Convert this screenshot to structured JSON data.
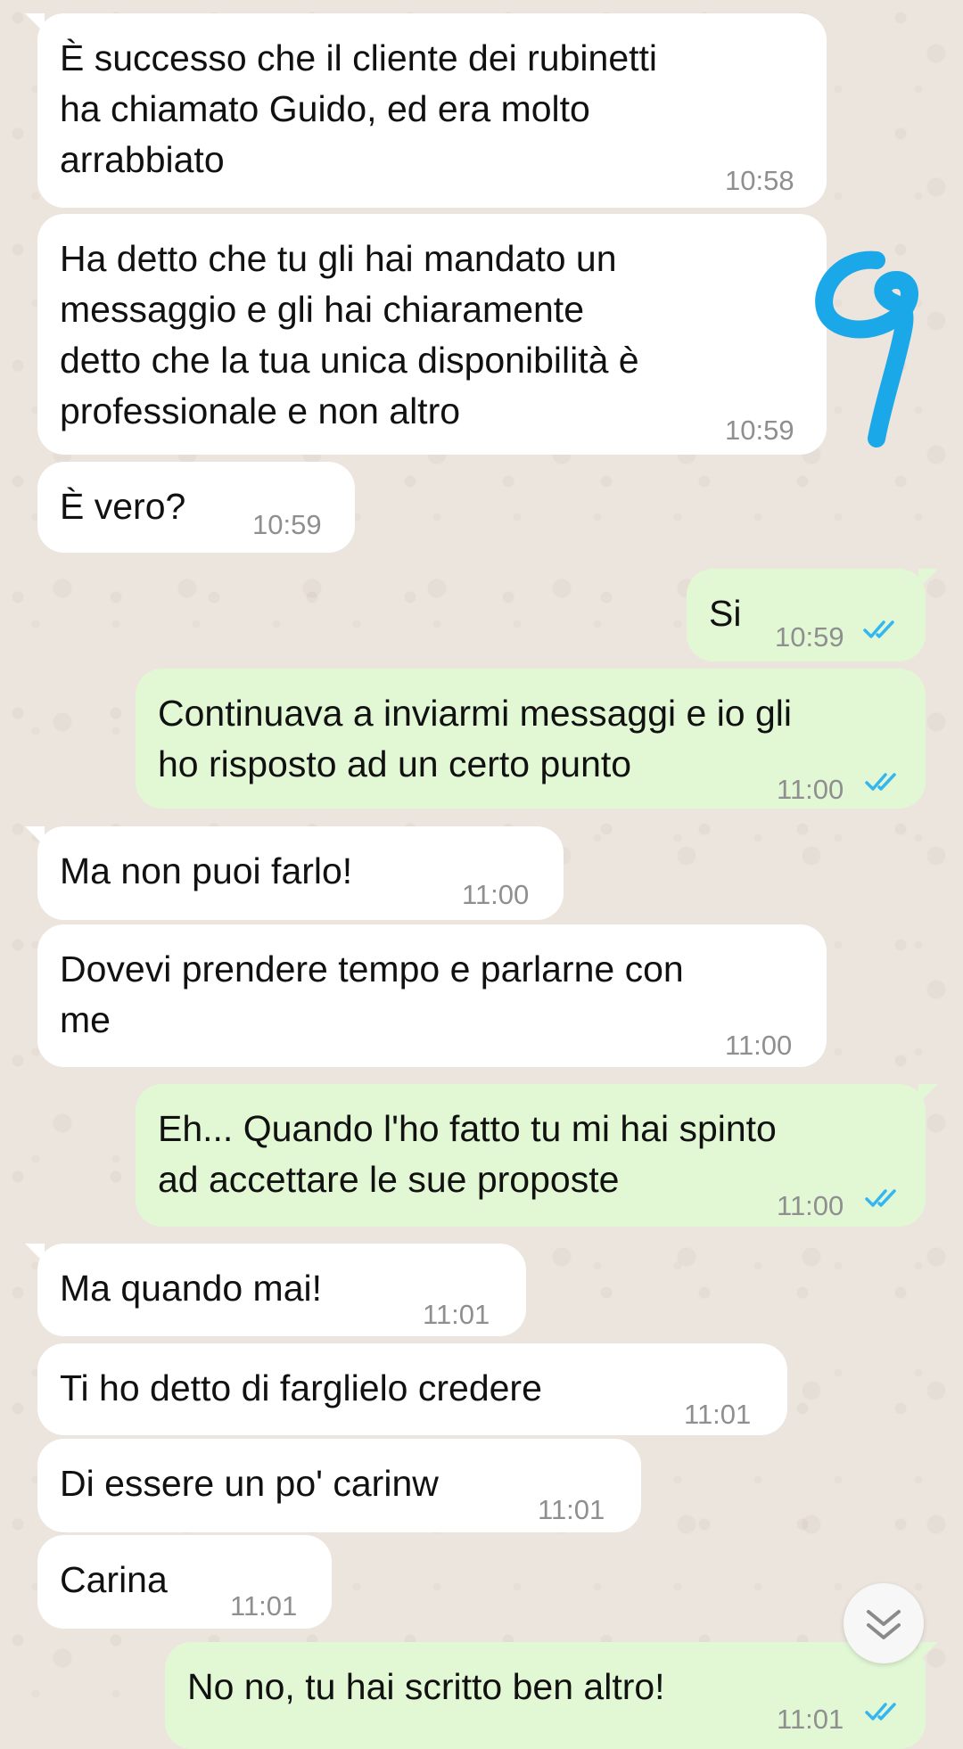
{
  "messages": [
    {
      "dir": "in",
      "lines": [
        "È successo che il cliente dei rubinetti",
        "ha chiamato Guido, ed era molto",
        "arrabbiato"
      ],
      "time": "10:58"
    },
    {
      "dir": "in",
      "lines": [
        "Ha detto che tu gli hai mandato un",
        "messaggio e gli hai chiaramente",
        "detto che la tua unica disponibilità è",
        "professionale e non altro"
      ],
      "time": "10:59"
    },
    {
      "dir": "in",
      "lines": [
        "È vero?"
      ],
      "time": "10:59"
    },
    {
      "dir": "out",
      "lines": [
        "Si"
      ],
      "time": "10:59",
      "status": "read"
    },
    {
      "dir": "out",
      "lines": [
        "Continuava a inviarmi messaggi e io gli",
        "ho risposto ad un certo punto"
      ],
      "time": "11:00",
      "status": "read"
    },
    {
      "dir": "in",
      "lines": [
        "Ma non puoi farlo!"
      ],
      "time": "11:00"
    },
    {
      "dir": "in",
      "lines": [
        "Dovevi prendere tempo e parlarne con",
        "me"
      ],
      "time": "11:00"
    },
    {
      "dir": "out",
      "lines": [
        "Eh... Quando l'ho fatto tu mi hai spinto",
        "ad accettare le sue proposte"
      ],
      "time": "11:00",
      "status": "read"
    },
    {
      "dir": "in",
      "lines": [
        "Ma quando mai!"
      ],
      "time": "11:01"
    },
    {
      "dir": "in",
      "lines": [
        "Ti ho detto di farglielo credere"
      ],
      "time": "11:01"
    },
    {
      "dir": "in",
      "lines": [
        "Di essere un po' carinw"
      ],
      "time": "11:01"
    },
    {
      "dir": "in",
      "lines": [
        "Carina"
      ],
      "time": "11:01"
    },
    {
      "dir": "out",
      "lines": [
        "No no, tu hai scritto ben altro!"
      ],
      "time": "11:01",
      "status": "read"
    }
  ],
  "scroll_button": {
    "icon": "double-chevron-down-icon"
  },
  "overlay": {
    "annotation": "9",
    "color": "#1BA8E8"
  },
  "colors": {
    "incoming_bubble": "#FFFFFF",
    "outgoing_bubble": "#E2F8D5",
    "timestamp": "#8f8f8f",
    "read_ticks": "#34B7F1",
    "wallpaper": "#ECE5DD"
  }
}
